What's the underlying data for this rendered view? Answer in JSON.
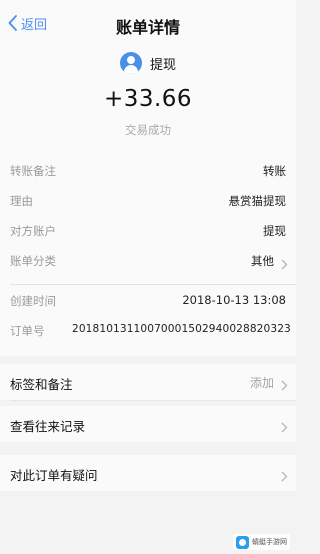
{
  "nav": {
    "back_label": "返回",
    "title": "账单详情"
  },
  "summary": {
    "payee": "提现",
    "amount": "+33.66",
    "status": "交易成功"
  },
  "details": {
    "rows": [
      {
        "label": "转账备注",
        "value": "转账"
      },
      {
        "label": "理由",
        "value": "悬赏猫提现"
      },
      {
        "label": "对方账户",
        "value": "提现"
      },
      {
        "label": "账单分类",
        "value": "其他"
      },
      {
        "label": "创建时间",
        "value": "2018-10-13 13:08"
      },
      {
        "label": "订单号",
        "value": "20181013110070001502940028820323"
      }
    ]
  },
  "actions": {
    "tags_label": "标签和备注",
    "tags_hint": "添加",
    "history_label": "查看往来记录",
    "question_label": "对此订单有疑问"
  },
  "watermark": {
    "text": "蜻蜓手游网"
  },
  "colors": {
    "accent": "#4b8ff0",
    "avatar": "#4a8fe7",
    "background": "#f3f3f3",
    "card": "#fafafa"
  }
}
